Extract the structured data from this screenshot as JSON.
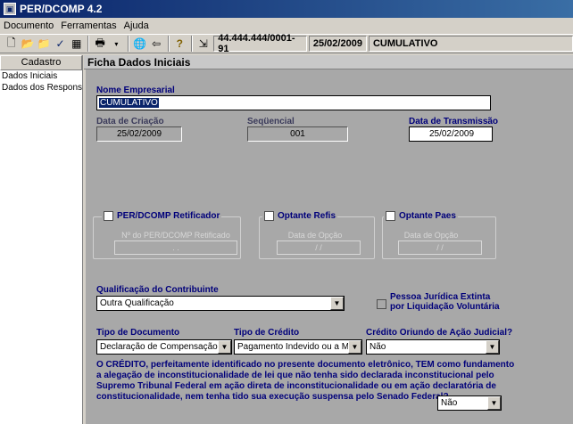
{
  "window": {
    "title": "PER/DCOMP 4.2"
  },
  "menu": [
    "Documento",
    "Ferramentas",
    "Ajuda"
  ],
  "toolbar": {
    "cnpj": "44.444.444/0001-91",
    "date": "25/02/2009",
    "status": "CUMULATIVO"
  },
  "sidebar": {
    "header": "Cadastro",
    "items": [
      "Dados Iniciais",
      "Dados dos Responsáv"
    ]
  },
  "form": {
    "title": "Ficha Dados Iniciais",
    "nome_empresarial": {
      "label": "Nome Empresarial",
      "value": "CUMULATIVO"
    },
    "data_criacao": {
      "label": "Data de Criação",
      "value": "25/02/2009"
    },
    "sequencial": {
      "label": "Seqüencial",
      "value": "001"
    },
    "data_transmissao": {
      "label": "Data de Transmissão",
      "value": "25/02/2009"
    },
    "retificador": {
      "label": "PER/DCOMP Retificador",
      "sublabel": "Nº do PER/DCOMP Retificado",
      "value": ". ."
    },
    "refis": {
      "label": "Optante Refis",
      "sublabel": "Data de Opção",
      "value": "/ /"
    },
    "paes": {
      "label": "Optante Paes",
      "sublabel": "Data de Opção",
      "value": "/ /"
    },
    "qualificacao": {
      "label": "Qualificação do Contribuinte",
      "value": "Outra Qualificação"
    },
    "extinta": {
      "label": "Pessoa Jurídica Extinta por Liquidação Voluntária"
    },
    "tipo_documento": {
      "label": "Tipo de Documento",
      "value": "Declaração de Compensação"
    },
    "tipo_credito": {
      "label": "Tipo de Crédito",
      "value": "Pagamento Indevido ou a Maior"
    },
    "credito_judicial": {
      "label": "Crédito Oriundo de Ação Judicial?",
      "value": "Não"
    },
    "credito_texto": "O CRÉDITO, perfeitamente identificado no presente documento eletrônico, TEM como fundamento a alegação de inconstitucionalidade de lei que não tenha sido declarada inconstitucional pelo Supremo Tribunal Federal em ação direta de inconstitucionalidade ou em ação declaratória de constitucionalidade, nem tenha tido sua execução suspensa pelo Senado Federal?",
    "credito_resposta": "Não"
  }
}
